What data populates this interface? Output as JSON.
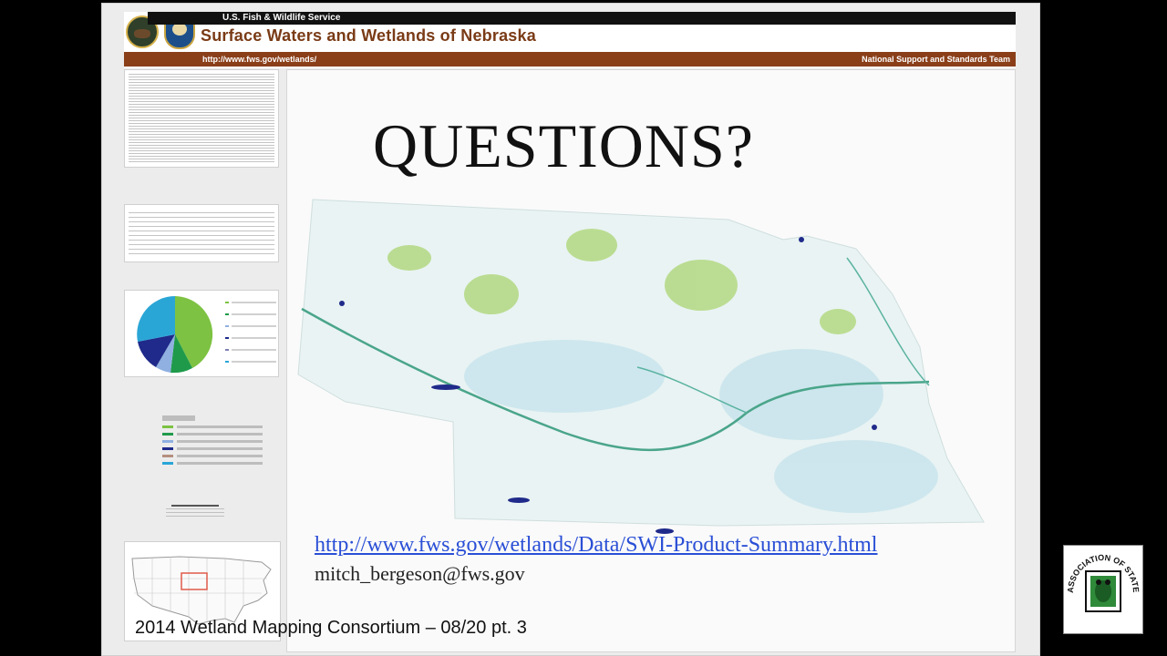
{
  "poster": {
    "agency": "U.S. Fish & Wildlife Service",
    "title": "Surface Waters and Wetlands of Nebraska",
    "url": "http://www.fws.gov/wetlands/",
    "team": "National Support and Standards Team"
  },
  "slide": {
    "heading": "QUESTIONS?",
    "link": "http://www.fws.gov/wetlands/Data/SWI-Product-Summary.html",
    "email": "mitch_bergeson@fws.gov"
  },
  "caption": "2014 Wetland Mapping Consortium – 08/20 pt. 3",
  "logo": {
    "arc_text": "ASSOCIATION OF STATE WETLAND MANAGERS"
  },
  "colors": {
    "emergent": "#7dc242",
    "forested": "#1f9a4b",
    "pond": "#8fb0e0",
    "lake": "#1f2a8a",
    "other": "#7f7fb5",
    "riverine": "#2aa6d6",
    "header_brown": "#8a3f19"
  }
}
